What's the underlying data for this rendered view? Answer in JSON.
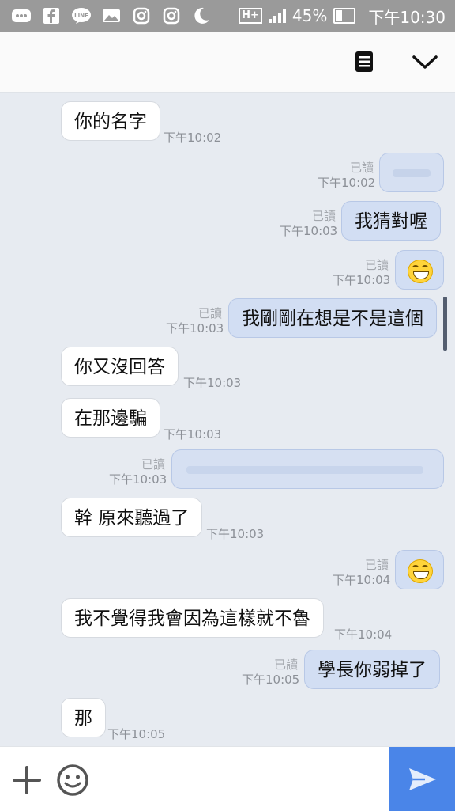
{
  "status_bar": {
    "battery_percent": "45%",
    "battery_level": 0.45,
    "time": "下午10:30",
    "network": "H+",
    "icons": [
      "more-icon",
      "facebook-icon",
      "line-icon",
      "gallery-icon",
      "instagram-icon",
      "instagram-icon",
      "moon-icon"
    ]
  },
  "header": {
    "icons": [
      "notes-icon",
      "chevron-down-icon"
    ]
  },
  "messages": [
    {
      "dir": "in",
      "text": "你的名字",
      "time": "下午10:02"
    },
    {
      "dir": "out",
      "text": "",
      "time": "下午10:02",
      "read": "已讀"
    },
    {
      "dir": "out",
      "text": "我猜對喔",
      "time": "下午10:03",
      "read": "已讀"
    },
    {
      "dir": "out",
      "emoji": "grinning-squint-emoji",
      "time": "下午10:03",
      "read": "已讀"
    },
    {
      "dir": "out",
      "text": "我剛剛在想是不是這個",
      "time": "下午10:03",
      "read": "已讀"
    },
    {
      "dir": "in",
      "text": "你又沒回答",
      "time": "下午10:03"
    },
    {
      "dir": "in",
      "text": "在那邊騙",
      "time": "下午10:03"
    },
    {
      "dir": "out",
      "text": "",
      "time": "下午10:03",
      "read": "已讀"
    },
    {
      "dir": "in",
      "text": "幹 原來聽過了",
      "time": "下午10:03"
    },
    {
      "dir": "out",
      "emoji": "grinning-squint-emoji",
      "time": "下午10:04",
      "read": "已讀"
    },
    {
      "dir": "in",
      "text": "我不覺得我會因為這樣就不魯",
      "time": "下午10:04"
    },
    {
      "dir": "out",
      "text": "學長你弱掉了",
      "time": "下午10:05",
      "read": "已讀"
    },
    {
      "dir": "in",
      "text": "那",
      "time": "下午10:05"
    }
  ],
  "input_bar": {
    "icons": [
      "plus-icon",
      "emoji-icon",
      "send-icon"
    ]
  }
}
